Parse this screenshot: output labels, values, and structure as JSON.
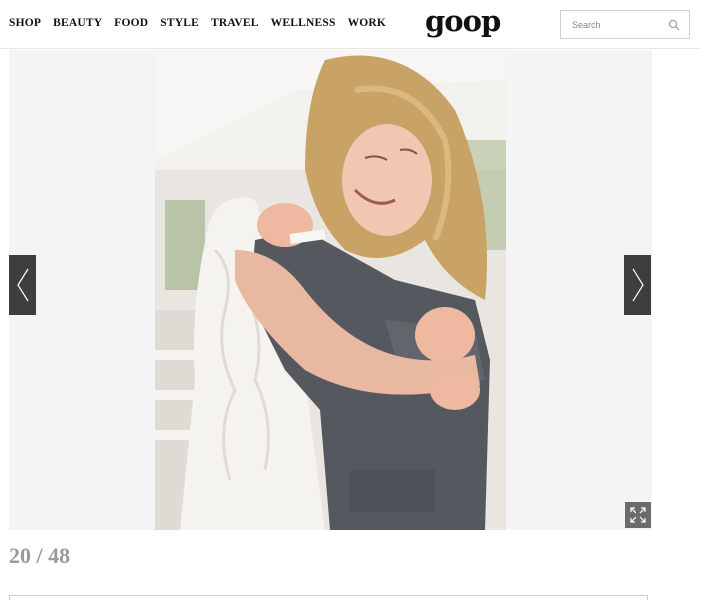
{
  "nav": {
    "items": [
      "SHOP",
      "BEAUTY",
      "FOOD",
      "STYLE",
      "TRAVEL",
      "WELLNESS",
      "WORK"
    ]
  },
  "logo": {
    "text": "goop"
  },
  "search": {
    "placeholder": "Search",
    "value": ""
  },
  "gallery": {
    "current": 20,
    "total": 48,
    "counter_text": "20 / 48",
    "photo_alt": "Bride in lace dress embracing a man in a grey suit"
  },
  "icons": {
    "search": "search-icon",
    "prev": "chevron-left-icon",
    "next": "chevron-right-icon",
    "expand": "expand-icon"
  }
}
